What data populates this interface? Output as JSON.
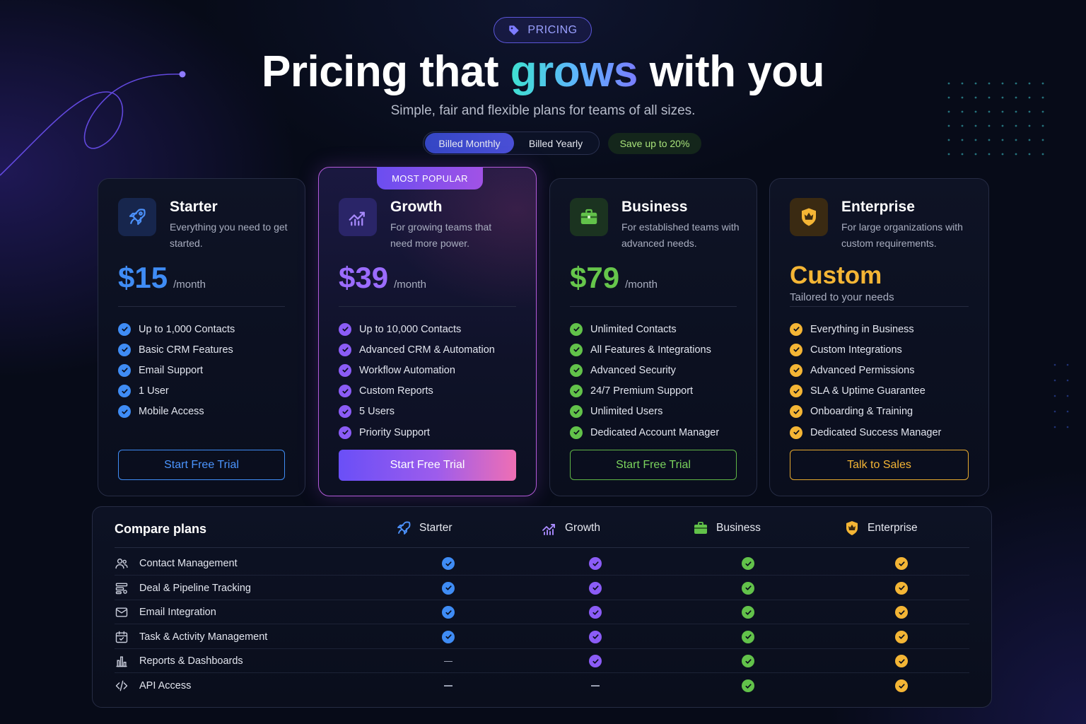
{
  "header": {
    "badge": "PRICING",
    "title_before": "Pricing that",
    "title_highlight": "grows",
    "title_after": "with you",
    "subtitle": "Simple, fair and flexible plans for teams of all sizes."
  },
  "billing": {
    "monthly": "Billed Monthly",
    "yearly": "Billed Yearly",
    "selected": "Billed Monthly",
    "save": "Save up to 20%"
  },
  "plans": [
    {
      "name": "Starter",
      "icon": "rocket-icon",
      "description": "Everything you need to get started.",
      "price": "$15",
      "period": "/month",
      "accent": "#3f8cf5",
      "features": [
        "Up to 1,000 Contacts",
        "Basic CRM Features",
        "Email Support",
        "1 User",
        "Mobile Access"
      ],
      "cta": "Start Free Trial"
    },
    {
      "name": "Growth",
      "icon": "growth-chart-icon",
      "badge": "MOST POPULAR",
      "description": "For growing teams that need more power.",
      "price": "$39",
      "period": "/month",
      "accent": "#8b5cf6",
      "features": [
        "Up to 10,000 Contacts",
        "Advanced CRM & Automation",
        "Workflow Automation",
        "Custom Reports",
        "5 Users",
        "Priority Support"
      ],
      "cta": "Start Free Trial"
    },
    {
      "name": "Business",
      "icon": "briefcase-icon",
      "description": "For established teams with advanced needs.",
      "price": "$79",
      "period": "/month",
      "accent": "#62c24a",
      "features": [
        "Unlimited Contacts",
        "All Features & Integrations",
        "Advanced Security",
        "24/7 Premium Support",
        "Unlimited Users",
        "Dedicated Account Manager"
      ],
      "cta": "Start Free Trial"
    },
    {
      "name": "Enterprise",
      "icon": "crown-icon",
      "description": "For large organizations with custom requirements.",
      "price": "Custom",
      "price_note": "Tailored to your needs",
      "accent": "#f4b535",
      "features": [
        "Everything in Business",
        "Custom Integrations",
        "Advanced Permissions",
        "SLA & Uptime Guarantee",
        "Onboarding & Training",
        "Dedicated Success Manager"
      ],
      "cta": "Talk to Sales"
    }
  ],
  "compare": {
    "title": "Compare plans",
    "columns": [
      "Starter",
      "Growth",
      "Business",
      "Enterprise"
    ],
    "rows": [
      {
        "feature": "Contact Management",
        "icon": "users-icon",
        "values": [
          true,
          true,
          true,
          true
        ]
      },
      {
        "feature": "Deal & Pipeline Tracking",
        "icon": "pipeline-icon",
        "values": [
          true,
          true,
          true,
          true
        ]
      },
      {
        "feature": "Email Integration",
        "icon": "mail-icon",
        "values": [
          true,
          true,
          true,
          true
        ]
      },
      {
        "feature": "Task & Activity Management",
        "icon": "calendar-check-icon",
        "values": [
          true,
          true,
          true,
          true
        ]
      },
      {
        "feature": "Reports & Dashboards",
        "icon": "bar-chart-icon",
        "values": [
          false,
          true,
          true,
          true
        ]
      },
      {
        "feature": "API Access",
        "icon": "code-icon",
        "values": [
          false,
          false,
          true,
          true
        ]
      }
    ]
  }
}
